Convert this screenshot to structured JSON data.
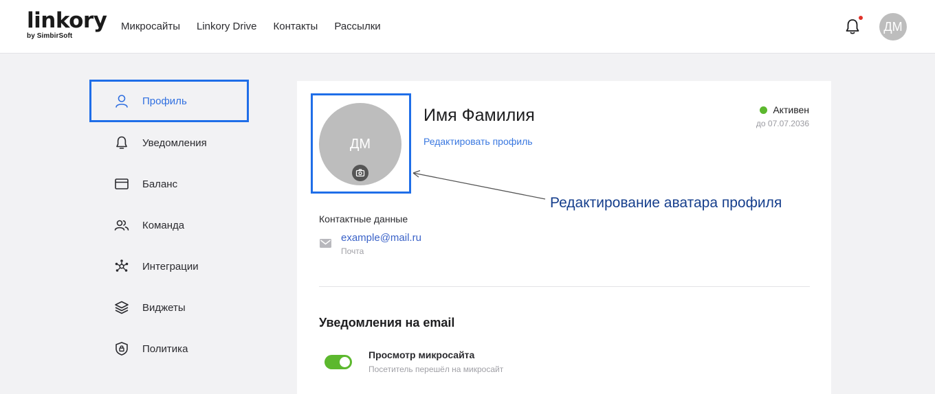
{
  "header": {
    "logo": "linkory",
    "logo_sub": "by SimbirSoft",
    "nav": [
      "Микросайты",
      "Linkory Drive",
      "Контакты",
      "Рассылки"
    ],
    "avatar_initials": "ДМ"
  },
  "sidebar": {
    "items": [
      {
        "label": "Профиль",
        "icon": "user-icon",
        "active": true
      },
      {
        "label": "Уведомления",
        "icon": "bell-icon"
      },
      {
        "label": "Баланс",
        "icon": "card-icon"
      },
      {
        "label": "Команда",
        "icon": "team-icon"
      },
      {
        "label": "Интеграции",
        "icon": "integrations-icon"
      },
      {
        "label": "Виджеты",
        "icon": "layers-icon"
      },
      {
        "label": "Политика",
        "icon": "shield-icon"
      }
    ]
  },
  "profile": {
    "avatar_initials": "ДМ",
    "name": "Имя Фамилия",
    "edit_link": "Редактировать профиль",
    "status": "Активен",
    "status_color": "#5cb82e",
    "status_until": "до 07.07.2036"
  },
  "annotation": "Редактирование аватара профиля",
  "contacts": {
    "title": "Контактные данные",
    "email": "example@mail.ru",
    "email_label": "Почта"
  },
  "email_notifications": {
    "title": "Уведомления на email",
    "items": [
      {
        "title": "Просмотр микросайта",
        "subtitle": "Посетитель перешёл на микросайт",
        "enabled": true
      }
    ]
  },
  "colors": {
    "accent": "#1f6ee8",
    "link": "#3a78e0",
    "toggle_on": "#5cb82e",
    "annotation": "#153e8c"
  }
}
